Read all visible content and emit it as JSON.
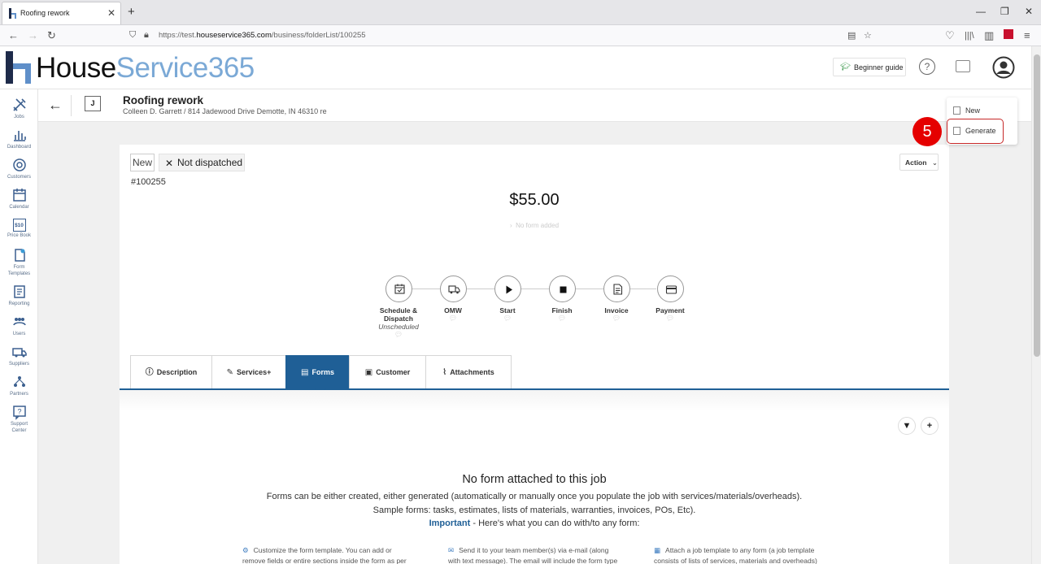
{
  "browser": {
    "tab_title": "Roofing rework",
    "new_tab": "+",
    "url_prefix": "https://test.",
    "url_domain": "houseservice365.com",
    "url_path": "/business/folderList/100255"
  },
  "header": {
    "logo_part1": "House",
    "logo_part2": "Service365",
    "beginner_guide": "Beginner guide",
    "help": "?"
  },
  "sidebar": {
    "items": [
      {
        "label": "Jobs",
        "icon": "tools-icon"
      },
      {
        "label": "Dashboard",
        "icon": "chart-icon"
      },
      {
        "label": "Customers",
        "icon": "customers-icon"
      },
      {
        "label": "Calendar",
        "icon": "calendar-icon"
      },
      {
        "label": "Price Book",
        "icon": "price-icon"
      },
      {
        "label": "Form",
        "label2": "Templates",
        "icon": "form-icon"
      },
      {
        "label": "Reporting",
        "icon": "report-icon"
      },
      {
        "label": "Users",
        "icon": "users-icon"
      },
      {
        "label": "Suppliers",
        "icon": "truck-icon"
      },
      {
        "label": "Partners",
        "icon": "partners-icon"
      },
      {
        "label": "Support",
        "label2": "Center",
        "icon": "support-icon"
      }
    ],
    "price_tag": "$10"
  },
  "job": {
    "avatar": "J",
    "title": "Roofing rework",
    "subtitle": "Colleen D. Garrett / 814 Jadewood Drive Demotte, IN 46310 re"
  },
  "dropdown": {
    "new": "New",
    "generate": "Generate"
  },
  "step_badge": "5",
  "card": {
    "status_new": "New",
    "status_dispatch": "Not dispatched",
    "job_number": "#100255",
    "action": "Action",
    "price": "$55.00",
    "no_form": "No form added"
  },
  "steps": [
    {
      "label": "Schedule &",
      "label2": "Dispatch",
      "sub": "Unscheduled"
    },
    {
      "label": "OMW"
    },
    {
      "label": "Start"
    },
    {
      "label": "Finish"
    },
    {
      "label": "Invoice"
    },
    {
      "label": "Payment"
    }
  ],
  "tabs": [
    {
      "label": "Description"
    },
    {
      "label": "Services+"
    },
    {
      "label": "Forms"
    },
    {
      "label": "Customer"
    },
    {
      "label": "Attachments"
    }
  ],
  "empty": {
    "title": "No form attached to this job",
    "line1": "Forms can be either created, either generated (automatically or manually once you populate the job with services/materials/overheads).",
    "line2": "Sample forms: tasks, estimates, lists of materials, warranties, invoices, POs, Etc).",
    "important": "Important",
    "line3": " - Here's what you can do with/to any form:"
  },
  "features": [
    {
      "line1": "Customize the form template. You can add or",
      "line2": "remove fields or entire sections inside the form as per"
    },
    {
      "line1": "Send it to your team member(s) via e-mail (along",
      "line2": "with text message). The email will include the form type"
    },
    {
      "line1": "Attach a job template to any form (a job template",
      "line2": "consists of lists of services, materials and overheads)"
    }
  ],
  "colors": {
    "accent": "#1f5f96",
    "logo_blue": "#7ba9d6",
    "badge_red": "#e50000"
  }
}
